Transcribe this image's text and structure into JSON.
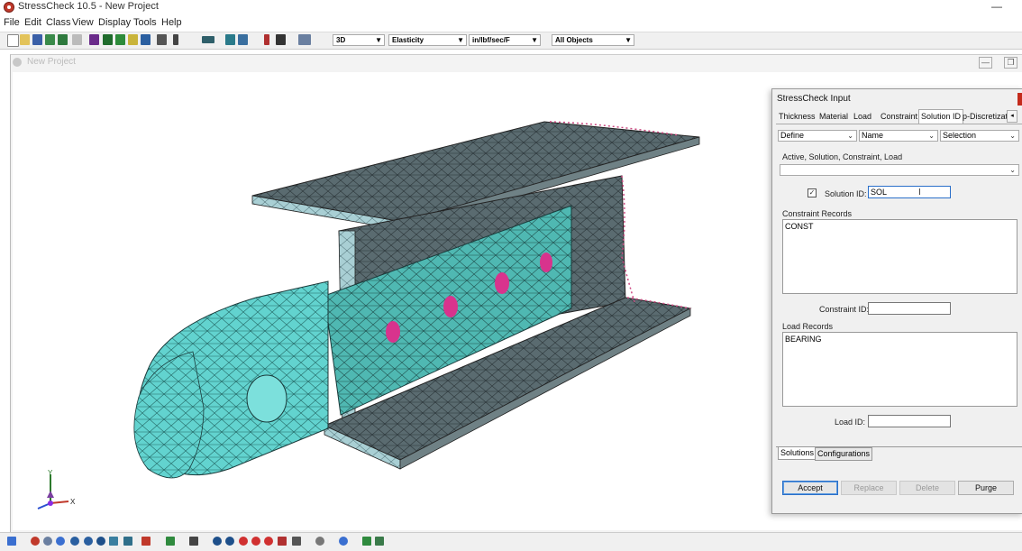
{
  "window": {
    "title": "StressCheck 10.5 - New Project",
    "minimize_label": "—"
  },
  "menu": [
    "File",
    "Edit",
    "Class",
    "View",
    "Display",
    "Tools",
    "Help"
  ],
  "toolbar": {
    "dimension": "3D",
    "analysis": "Elasticity",
    "units": "in/lbf/sec/F",
    "objects": "All Objects"
  },
  "child_window": {
    "title": "New Project",
    "minimize_label": "—",
    "restore_label": "❐"
  },
  "axis": {
    "y_label": "Y",
    "x_label": "X"
  },
  "dialog": {
    "title": "StressCheck Input",
    "tabs": [
      "Thickness",
      "Material",
      "Load",
      "Constraint",
      "Solution ID",
      "p-Discretizatio"
    ],
    "active_tab": "Solution ID",
    "tab_scroll": "◂",
    "combos": {
      "mode": "Define",
      "name": "Name",
      "selection": "Selection"
    },
    "active_label": "Active, Solution, Constraint, Load",
    "active_value": "",
    "checkbox_mark": "✓",
    "solution_id_label": "Solution ID:",
    "solution_id_value": "SOL",
    "constraint_records_label": "Constraint Records",
    "constraint_records": [
      "CONST"
    ],
    "constraint_id_label": "Constraint ID:",
    "constraint_id_value": "",
    "load_records_label": "Load Records",
    "load_records": [
      "BEARING"
    ],
    "load_id_label": "Load ID:",
    "load_id_value": "",
    "bottom_tabs": [
      "Solutions",
      "Configurations"
    ],
    "buttons": {
      "accept": "Accept",
      "replace": "Replace",
      "delete": "Delete",
      "purge": "Purge"
    }
  },
  "colors": {
    "mesh_teal": "#4fb8b2",
    "mesh_dark": "#5a6b70",
    "hotspot_magenta": "#d8338d",
    "close_red": "#c42b1c"
  }
}
